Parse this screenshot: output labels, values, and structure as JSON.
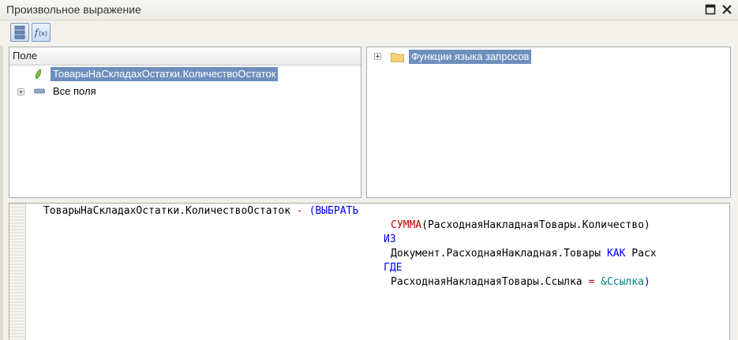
{
  "window": {
    "title": "Произвольное выражение"
  },
  "toolbar": {
    "buttons": [
      {
        "icon": "list-icon"
      },
      {
        "icon": "function-icon"
      }
    ]
  },
  "fields_panel": {
    "header": "Поле",
    "items": [
      {
        "label": "ТоварыНаСкладахОстатки.КоличествоОстаток",
        "selected": true,
        "icon": "field-icon"
      },
      {
        "label": "Все поля",
        "selected": false,
        "icon": "table-icon",
        "expandable": true
      }
    ]
  },
  "functions_panel": {
    "items": [
      {
        "label": "Функции языка запросов",
        "selected": true,
        "icon": "folder-icon",
        "expandable": true
      }
    ]
  },
  "editor": {
    "line1_field": "ТоварыНаСкладахОстатки.КоличествоОстаток",
    "line1_op": "-",
    "line1_paren": "(",
    "line1_kw": "ВЫБРАТЬ",
    "line2_fn": "СУММА",
    "line2_arg": "(РасходнаяНакладнаяТовары.Количество)",
    "line3_kw": "ИЗ",
    "line4_text": "Документ.РасходнаяНакладная.Товары",
    "line4_kw": "КАК",
    "line4_alias": "Расх",
    "line5_kw": "ГДЕ",
    "line6_text": "РасходнаяНакладнаяТовары.Ссылка",
    "line6_op": "=",
    "line6_param": "&Ссылка",
    "line6_close": ")"
  }
}
